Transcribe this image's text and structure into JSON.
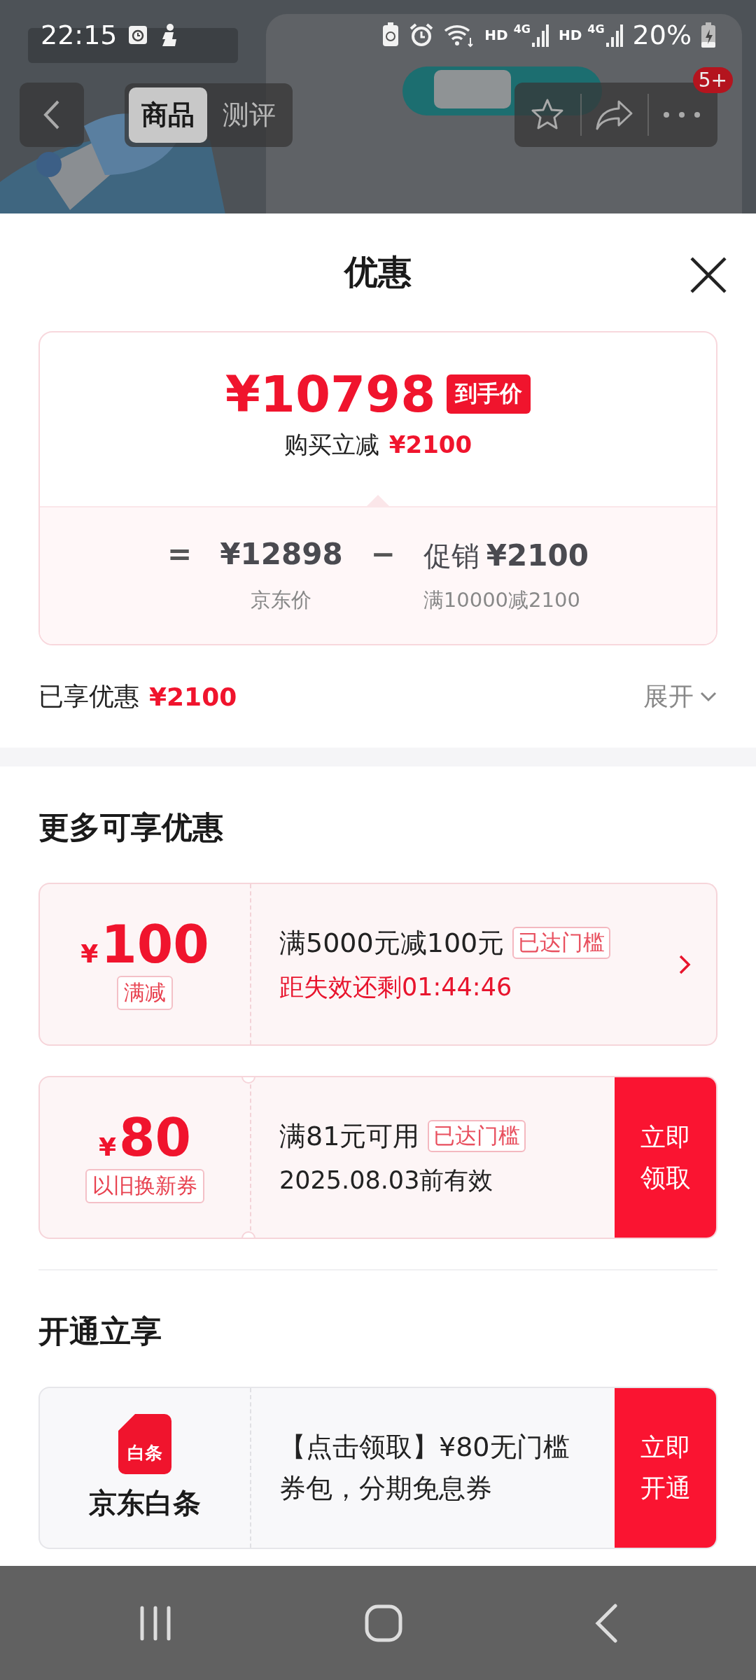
{
  "status_bar": {
    "time": "22:15",
    "signals": [
      {
        "hd": "HD",
        "net": "4G"
      },
      {
        "hd": "HD",
        "net": "4G"
      }
    ],
    "battery": "20%"
  },
  "nav": {
    "tabs": [
      {
        "label": "商品",
        "selected": true
      },
      {
        "label": "测评",
        "selected": false
      }
    ],
    "badge": "5+"
  },
  "sheet": {
    "title": "优惠",
    "price_card": {
      "final_price": "¥10798",
      "final_label": "到手价",
      "reduction_label": "购买立减",
      "reduction": "¥2100",
      "equals": "=",
      "base_price": "¥12898",
      "base_label": "京东价",
      "minus": "−",
      "promo_label": "促销",
      "promo_amount": "¥2100",
      "promo_rule": "满10000减2100"
    },
    "enjoyed": {
      "label": "已享优惠",
      "amount": "¥2100",
      "expand": "展开"
    },
    "more_heading": "更多可享优惠",
    "coupons": [
      {
        "kind": "arrow",
        "currency": "¥",
        "amount": "100",
        "type": "满减",
        "title": "满5000元减100元",
        "tag": "已达门槛",
        "note": "距失效还剩01:44:46",
        "note_urgent": true
      },
      {
        "kind": "button",
        "currency": "¥",
        "amount": "80",
        "type": "以旧换新券",
        "title": "满81元可用",
        "tag": "已达门槛",
        "note": "2025.08.03前有效",
        "note_urgent": false,
        "action": "立即领取"
      }
    ],
    "open_heading": "开通立享",
    "offers": [
      {
        "logo": "白条",
        "name": "京东白条",
        "description": "【点击领取】¥80无门槛券包，分期免息券",
        "action": "立即开通"
      }
    ]
  }
}
